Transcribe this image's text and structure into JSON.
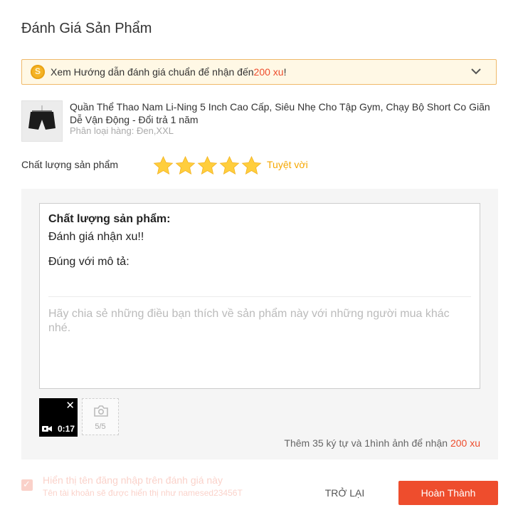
{
  "dialog": {
    "title": "Đánh Giá Sản Phẩm"
  },
  "guide": {
    "text": "Xem Hướng dẫn đánh giá chuẩn để nhận đến ",
    "amount": "200 xu",
    "suffix": "!"
  },
  "product": {
    "name": "Quần Thể Thao Nam Li-Ning 5 Inch Cao Cấp, Siêu Nhẹ Cho Tập Gym, Chạy Bộ Short Co Giãn Dễ Vận Động - Đổi trả 1 năm",
    "variant": "Phân loại hàng: Đen,XXL"
  },
  "quality": {
    "label": "Chất lượng sản phẩm",
    "stars": 5,
    "max_stars": 5,
    "rating_text": "Tuyệt vời",
    "star_color": "#ffce3d"
  },
  "review": {
    "heading": "Chất lượng sản phẩm:",
    "line1": "Đánh giá nhận xu!!",
    "line2": "Đúng với mô tả:",
    "placeholder": "Hãy chia sẻ những điều bạn thích về sản phẩm này với những người mua khác nhé."
  },
  "media": {
    "video_duration": "0:17",
    "photo_count": "5/5"
  },
  "hint": {
    "text": "Thêm 35 ký tự và 1hình ảnh để nhận ",
    "amount": "200 xu"
  },
  "footer": {
    "show_username_label": "Hiển thị tên đăng nhập trên đánh giá này",
    "show_username_sub": "Tên tài khoản sẽ được hiển thị như namesed23456T",
    "back_label": "TRỞ LẠI",
    "done_label": "Hoàn Thành"
  },
  "colors": {
    "accent": "#ee4d2d",
    "rating": "#f6a700"
  }
}
